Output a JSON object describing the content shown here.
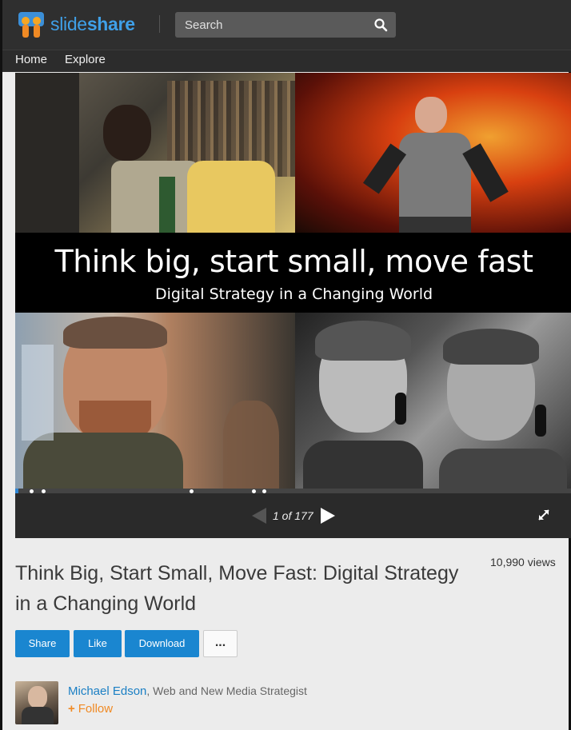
{
  "header": {
    "logo_part1": "slide",
    "logo_part2": "share",
    "search_placeholder": "Search"
  },
  "nav": {
    "items": [
      {
        "label": "Home"
      },
      {
        "label": "Explore"
      }
    ]
  },
  "slide": {
    "title": "Think big, start small, move fast",
    "subtitle": "Digital Strategy in a Changing World"
  },
  "player": {
    "page_counter": "1 of 177",
    "current_page": 1,
    "total_pages": 177
  },
  "document": {
    "title": "Think Big, Start Small, Move Fast: Digital Strategy in a Changing World",
    "views": "10,990 views"
  },
  "actions": {
    "share_label": "Share",
    "like_label": "Like",
    "download_label": "Download",
    "more_label": "..."
  },
  "author": {
    "name": "Michael Edson",
    "role": ", Web and New Media Strategist",
    "follow_label": "Follow",
    "follow_prefix": "+"
  },
  "colors": {
    "brand_blue": "#1a86d0",
    "follow_orange": "#f08a24",
    "topbar": "#2f2f2f"
  }
}
